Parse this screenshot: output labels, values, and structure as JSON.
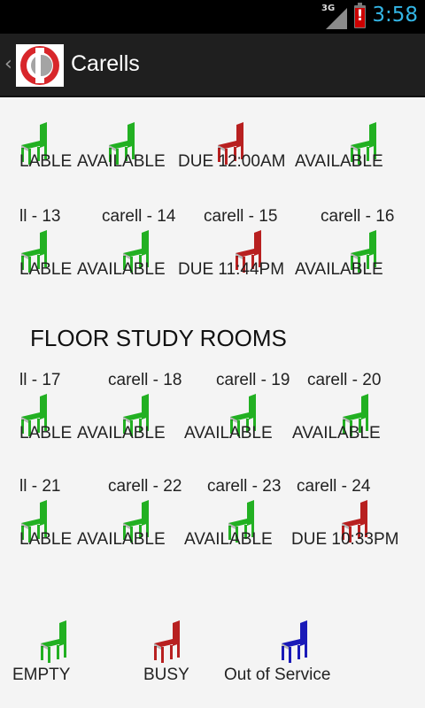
{
  "status_bar": {
    "clock": "3:58",
    "network": "3G",
    "battery_alert": "!"
  },
  "app": {
    "title": "Carells"
  },
  "colors": {
    "available": "#22b022",
    "busy": "#b82020",
    "out_of_service": "#1a1ab8"
  },
  "rows": [
    {
      "cells": [
        {
          "label": "",
          "status_text": "LABLE",
          "status": "available"
        },
        {
          "label": "",
          "status_text": "AVAILABLE",
          "status": "available"
        },
        {
          "label": "",
          "status_text": "DUE 12:00AM",
          "status": "busy"
        },
        {
          "label": "",
          "status_text": "AVAILABLE",
          "status": "available"
        }
      ]
    },
    {
      "cells": [
        {
          "label": "ll - 13",
          "status_text": "LABLE",
          "status": "available"
        },
        {
          "label": "carell - 14",
          "status_text": "AVAILABLE",
          "status": "available"
        },
        {
          "label": "carell - 15",
          "status_text": "DUE 11:44PM",
          "status": "busy"
        },
        {
          "label": "carell - 16",
          "status_text": "AVAILABLE",
          "status": "available"
        }
      ]
    },
    {
      "cells": [
        {
          "label": "ll - 17",
          "status_text": "LABLE",
          "status": "available"
        },
        {
          "label": "carell - 18",
          "status_text": "AVAILABLE",
          "status": "available"
        },
        {
          "label": "carell - 19",
          "status_text": "AVAILABLE",
          "status": "available"
        },
        {
          "label": "carell - 20",
          "status_text": "AVAILABLE",
          "status": "available"
        }
      ]
    },
    {
      "cells": [
        {
          "label": "ll - 21",
          "status_text": "LABLE",
          "status": "available"
        },
        {
          "label": "carell - 22",
          "status_text": "AVAILABLE",
          "status": "available"
        },
        {
          "label": "carell - 23",
          "status_text": "AVAILABLE",
          "status": "available"
        },
        {
          "label": "carell - 24",
          "status_text": "DUE 10:33PM",
          "status": "busy"
        }
      ]
    }
  ],
  "section_title": "FLOOR STUDY ROOMS",
  "legend": [
    {
      "label": "EMPTY",
      "status": "available"
    },
    {
      "label": "BUSY",
      "status": "busy"
    },
    {
      "label": "Out of Service",
      "status": "out_of_service"
    }
  ]
}
